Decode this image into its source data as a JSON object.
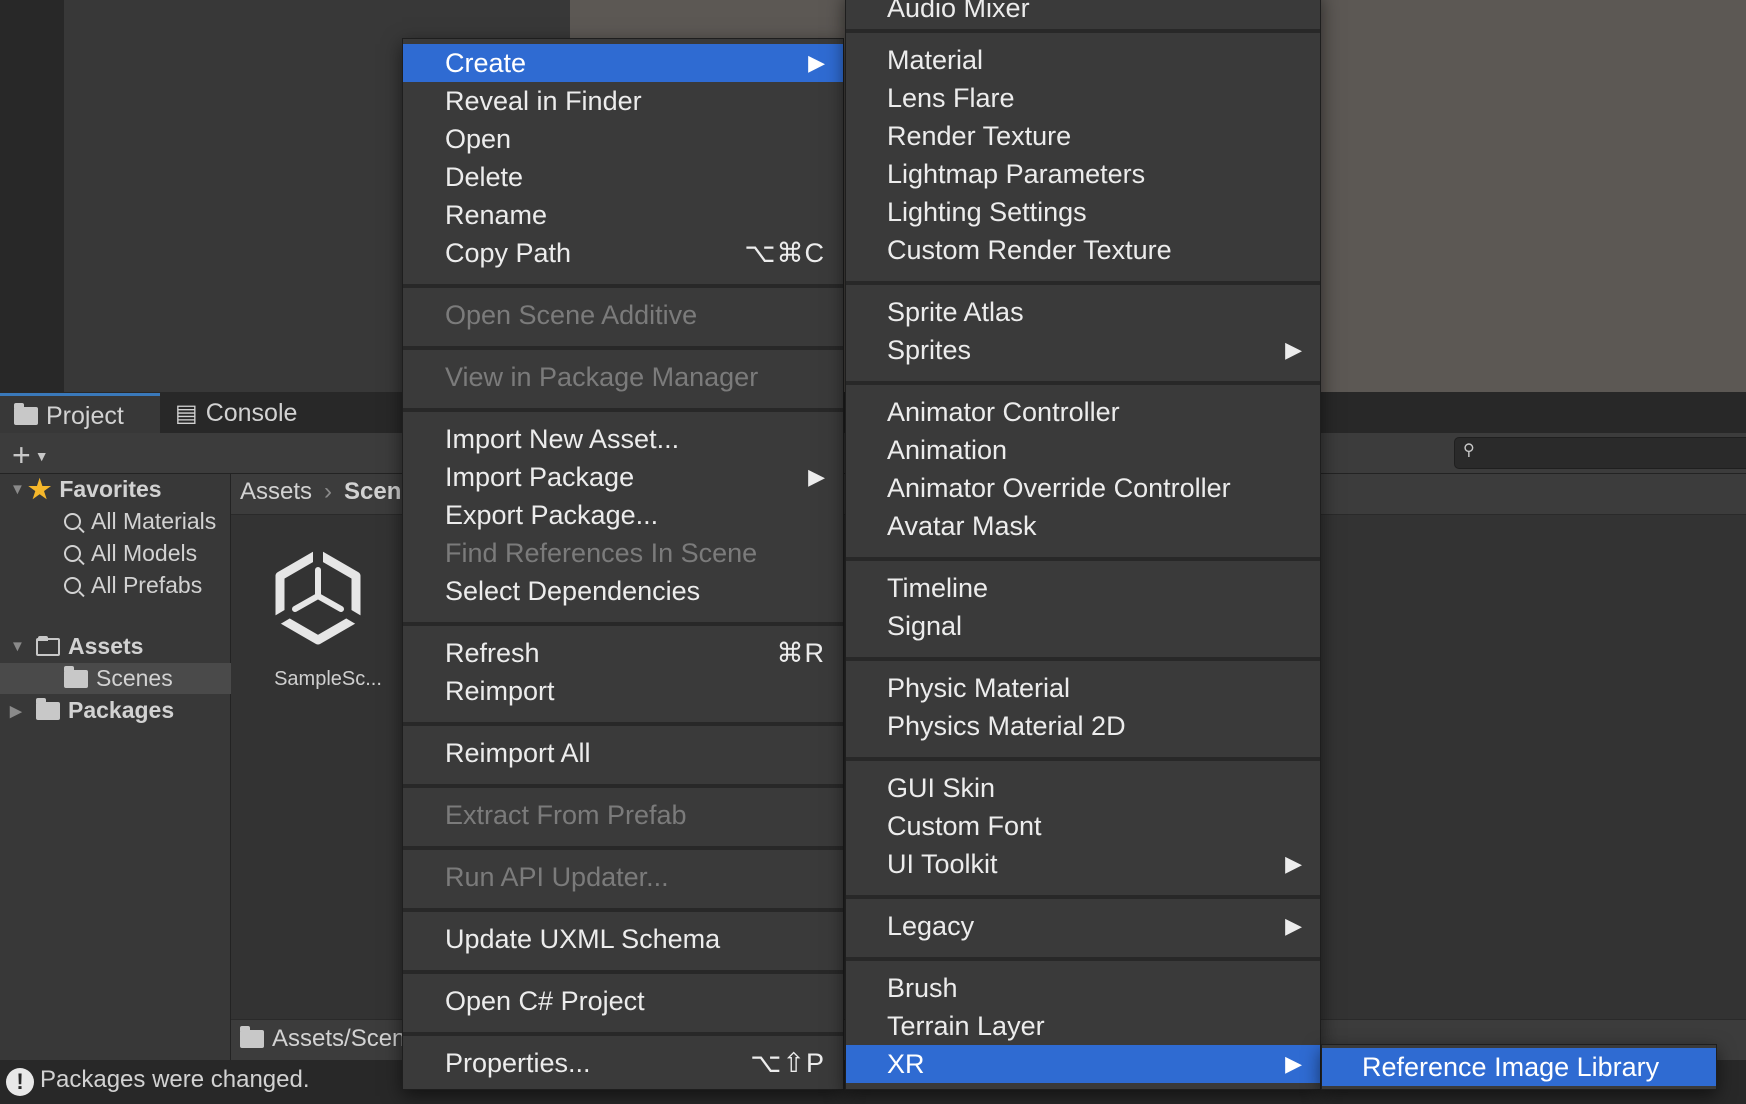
{
  "project_panel": {
    "tabs": [
      {
        "label": "Project"
      },
      {
        "label": "Console"
      }
    ],
    "search_placeholder": "",
    "tree": {
      "favorites": "Favorites",
      "all_materials": "All Materials",
      "all_models": "All Models",
      "all_prefabs": "All Prefabs",
      "assets": "Assets",
      "scenes": "Scenes",
      "packages": "Packages"
    },
    "breadcrumb": {
      "root": "Assets",
      "current": "Scenes"
    },
    "asset_tile": "SampleSc...",
    "path_bar": "Assets/Scenes"
  },
  "status_bar": {
    "text": "Packages were changed."
  },
  "context_menu": {
    "create": "Create",
    "reveal_in_finder": "Reveal in Finder",
    "open": "Open",
    "delete": "Delete",
    "rename": "Rename",
    "copy_path": "Copy Path",
    "copy_path_shortcut": "⌥⌘C",
    "open_scene_additive": "Open Scene Additive",
    "view_in_package_manager": "View in Package Manager",
    "import_new_asset": "Import New Asset...",
    "import_package": "Import Package",
    "export_package": "Export Package...",
    "find_references": "Find References In Scene",
    "select_dependencies": "Select Dependencies",
    "refresh": "Refresh",
    "refresh_shortcut": "⌘R",
    "reimport": "Reimport",
    "reimport_all": "Reimport All",
    "extract_from_prefab": "Extract From Prefab",
    "run_api_updater": "Run API Updater...",
    "update_uxml_schema": "Update UXML Schema",
    "open_csharp_project": "Open C# Project",
    "properties": "Properties...",
    "properties_shortcut": "⌥⇧P"
  },
  "create_submenu": {
    "audio_mixer": "Audio Mixer",
    "material": "Material",
    "lens_flare": "Lens Flare",
    "render_texture": "Render Texture",
    "lightmap_parameters": "Lightmap Parameters",
    "lighting_settings": "Lighting Settings",
    "custom_render_texture": "Custom Render Texture",
    "sprite_atlas": "Sprite Atlas",
    "sprites": "Sprites",
    "animator_controller": "Animator Controller",
    "animation": "Animation",
    "animator_override_controller": "Animator Override Controller",
    "avatar_mask": "Avatar Mask",
    "timeline": "Timeline",
    "signal": "Signal",
    "physic_material": "Physic Material",
    "physics_material_2d": "Physics Material 2D",
    "gui_skin": "GUI Skin",
    "custom_font": "Custom Font",
    "ui_toolkit": "UI Toolkit",
    "legacy": "Legacy",
    "brush": "Brush",
    "terrain_layer": "Terrain Layer",
    "xr": "XR"
  },
  "xr_submenu": {
    "reference_image_library": "Reference Image Library"
  },
  "colors": {
    "highlight": "#2f6bd2",
    "menu_bg": "#3a3a3a",
    "disabled_text": "#7b7b7b",
    "favorites_star": "#f5b72b"
  }
}
